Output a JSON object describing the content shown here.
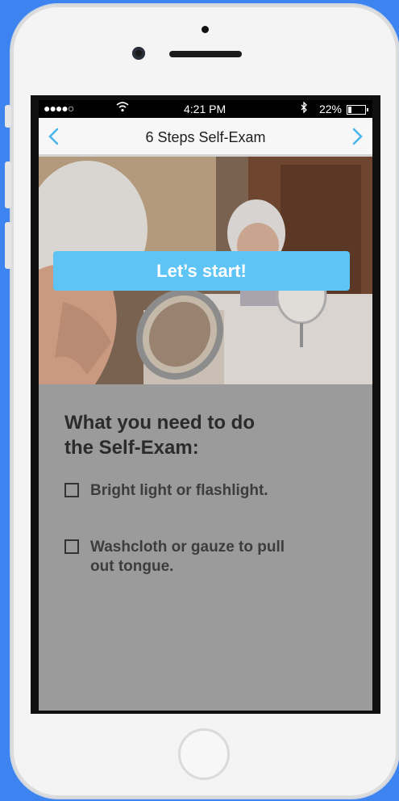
{
  "status_bar": {
    "signal": "●●●●○",
    "time": "4:21 PM",
    "battery_percent": "22%",
    "battery_level": 0.22
  },
  "nav": {
    "title": "6 Steps Self-Exam",
    "back_icon": "chevron-left-icon",
    "forward_icon": "chevron-right-icon"
  },
  "hero": {
    "start_label": "Let’s start!"
  },
  "content": {
    "heading_line1": "What you need to do",
    "heading_line2": "the Self-Exam:",
    "items": [
      {
        "label_line1": "Bright light or flashlight.",
        "label_line2": "",
        "checked": false
      },
      {
        "label_line1": "Washcloth or gauze to pull",
        "label_line2": "out tongue.",
        "checked": false
      }
    ]
  },
  "colors": {
    "accent": "#5ec3f5",
    "background": "#3d84f0"
  }
}
